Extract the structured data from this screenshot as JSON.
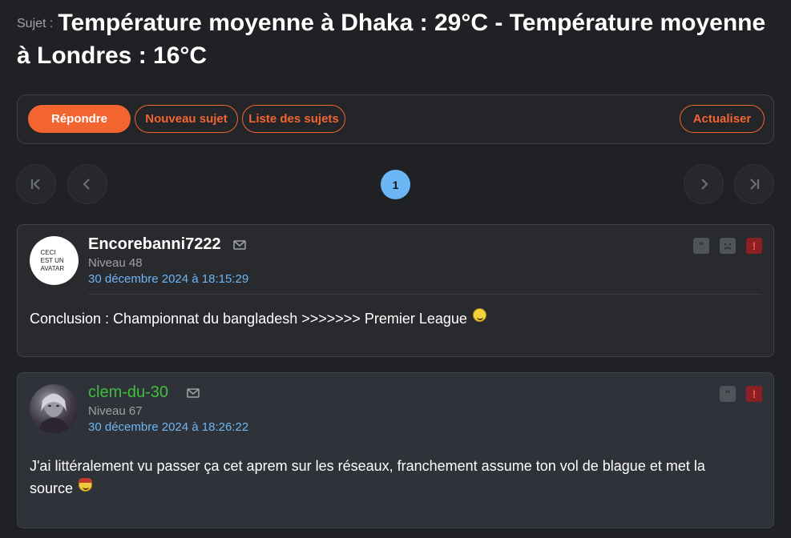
{
  "topic": {
    "prefix": "Sujet :",
    "title": "Température moyenne à Dhaka : 29°C - Température moyenne à Londres : 16°C"
  },
  "toolbar": {
    "reply_label": "Répondre",
    "new_topic_label": "Nouveau sujet",
    "topic_list_label": "Liste des sujets",
    "refresh_label": "Actualiser"
  },
  "pagination": {
    "current_page": "1"
  },
  "posts": [
    {
      "author": "Encorebanni7222",
      "avatar_text": "CECI EST UN AVATAR",
      "level": "Niveau 48",
      "date": "30 décembre 2024 à 18:15:29",
      "message": "Conclusion : Championnat du bangladesh >>>>>>> Premier League",
      "smiley": "smiley-icon"
    },
    {
      "author": "clem-du-30",
      "level": "Niveau 67",
      "date": "30 décembre 2024 à 18:26:22",
      "message": "J'ai littéralement vu passer ça cet aprem sur les réseaux, franchement assume ton vol de blague et met la source",
      "smiley": "pirate-smiley-icon"
    }
  ],
  "colors": {
    "accent": "#f26430",
    "link": "#6cb6f5",
    "background": "#202124",
    "moderator_name": "#3fbf3f",
    "alert": "#8b2023"
  }
}
